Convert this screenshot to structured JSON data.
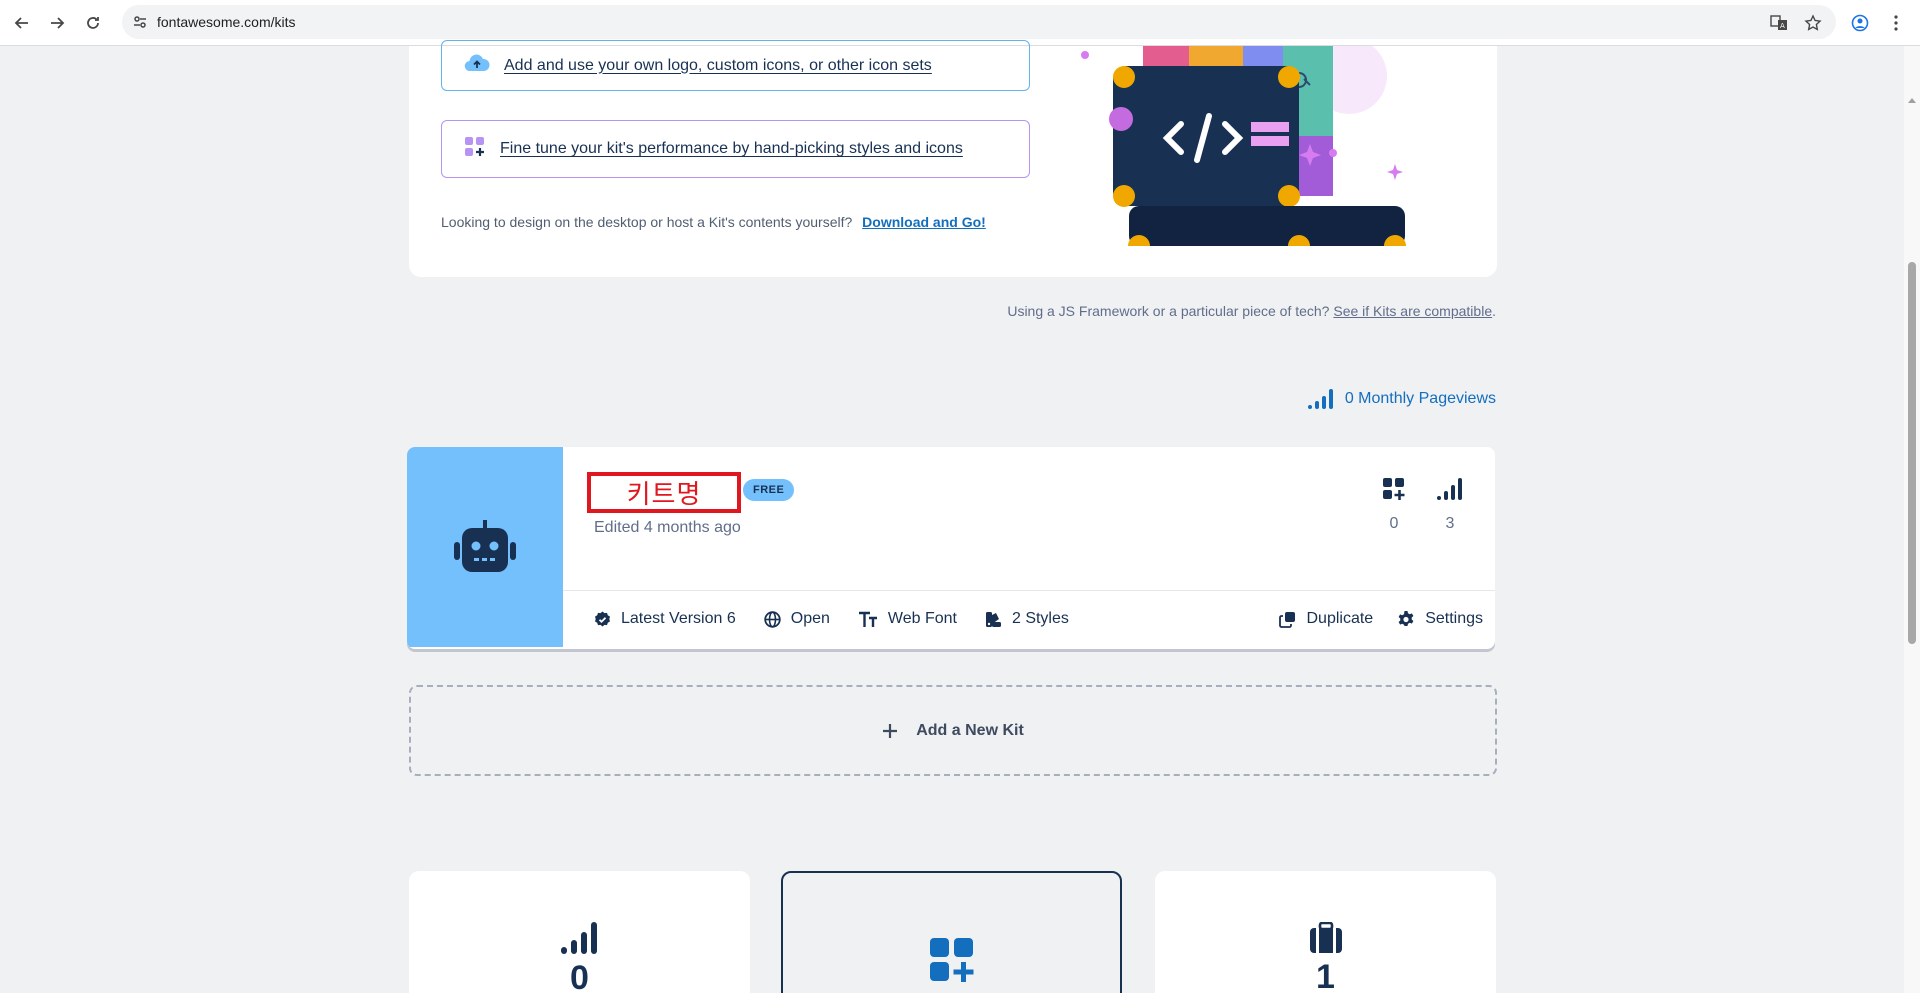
{
  "browser": {
    "url": "fontawesome.com/kits",
    "icons": [
      "back-arrow-icon",
      "forward-arrow-icon",
      "reload-icon",
      "site-settings-icon",
      "translate-icon",
      "star-icon",
      "profile-icon",
      "more-icon"
    ]
  },
  "top_card": {
    "option_upload": "Add and use your own logo, custom icons, or other icon sets",
    "option_finetune": "Fine tune your kit's performance by hand-picking styles and icons",
    "desktop_text": "Looking to design on the desktop or host a Kit's contents yourself?",
    "download_link": "Download and Go!"
  },
  "compat": {
    "text": "Using a JS Framework or a particular piece of tech?",
    "link": "See if Kits are compatible",
    "suffix": "."
  },
  "pageviews": "0 Monthly Pageviews",
  "kit": {
    "name": "키트명",
    "badge": "FREE",
    "edited": "Edited 4 months ago",
    "stats": [
      {
        "icon": "icons-plus-icon",
        "value": "0"
      },
      {
        "icon": "signal-icon",
        "value": "3"
      }
    ],
    "footer": {
      "version": "Latest Version 6",
      "open": "Open",
      "tech": "Web Font",
      "styles": "2 Styles",
      "duplicate": "Duplicate",
      "settings": "Settings"
    }
  },
  "add_kit": "Add a New Kit",
  "bottom_cards": [
    {
      "icon": "signal-icon",
      "value": "0"
    },
    {
      "icon": "icons-plus-icon",
      "value": ""
    },
    {
      "icon": "briefcase-icon",
      "value": "1"
    }
  ],
  "colors": {
    "brand_navy": "#183153",
    "link_blue": "#146ebe",
    "kit_avatar_bg": "#74c0fc",
    "highlight_red": "#e0171f"
  }
}
